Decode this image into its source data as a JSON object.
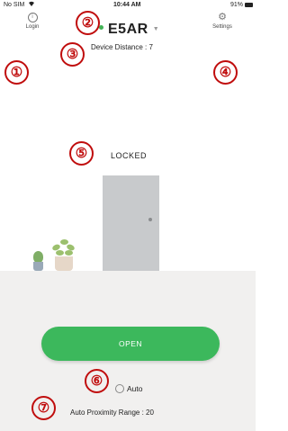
{
  "status_bar": {
    "carrier": "No SIM",
    "time": "10:44 AM",
    "battery": "91%"
  },
  "header": {
    "login_label": "Login",
    "settings_label": "Settings",
    "device_name": "E5AR",
    "device_distance": "Device Distance : 7"
  },
  "main": {
    "state_label": "LOCKED",
    "open_label": "OPEN",
    "auto_label": "Auto",
    "proximity_range": "Auto Proximity Range : 20"
  },
  "markers": [
    "①",
    "②",
    "③",
    "④",
    "⑤",
    "⑥",
    "⑦"
  ],
  "colors": {
    "accent": "#3cb85c",
    "marker": "#c00d0d",
    "door": "#c8cacc",
    "floor": "#f1f0ef"
  },
  "icons": {
    "login": "info-circle-icon",
    "settings": "gear-icon"
  }
}
